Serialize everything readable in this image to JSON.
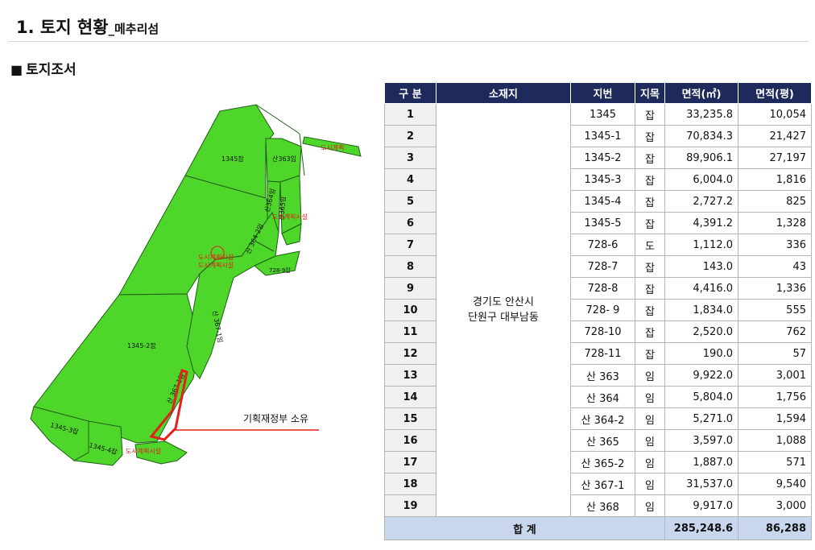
{
  "header": {
    "title": "1. 토지 현황",
    "subtitle": "_메추리섬"
  },
  "section": {
    "marker": "■",
    "title": "토지조서"
  },
  "map": {
    "parcels": [
      "1345잡",
      "1345-2잡",
      "1345-3잡",
      "1345-4잡",
      "산363임",
      "산364임",
      "산 367-1임",
      "산365임",
      "728-9잡",
      "산 364-2임",
      "산 367-1임"
    ],
    "overlay_labels": [
      "도시계획",
      "도시계획시설",
      "도시계획시설",
      "도시계획시설",
      "도시계획시설"
    ],
    "callout": "기획재정부 소유",
    "colors": {
      "parcel_fill": "#4fd62a",
      "parcel_border": "#1e5e14",
      "highlight": "#e3201b",
      "callout_line": "#e3201b"
    }
  },
  "table": {
    "headers": [
      "구 분",
      "소재지",
      "지번",
      "지목",
      "면적(㎡)",
      "면적(평)"
    ],
    "location": [
      "경기도 안산시",
      "단원구 대부남동"
    ],
    "rows": [
      {
        "no": "1",
        "lot": "1345",
        "cat": "잡",
        "sqm": "33,235.8",
        "pyeong": "10,054"
      },
      {
        "no": "2",
        "lot": "1345-1",
        "cat": "잡",
        "sqm": "70,834.3",
        "pyeong": "21,427"
      },
      {
        "no": "3",
        "lot": "1345-2",
        "cat": "잡",
        "sqm": "89,906.1",
        "pyeong": "27,197"
      },
      {
        "no": "4",
        "lot": "1345-3",
        "cat": "잡",
        "sqm": "6,004.0",
        "pyeong": "1,816"
      },
      {
        "no": "5",
        "lot": "1345-4",
        "cat": "잡",
        "sqm": "2,727.2",
        "pyeong": "825"
      },
      {
        "no": "6",
        "lot": "1345-5",
        "cat": "잡",
        "sqm": "4,391.2",
        "pyeong": "1,328"
      },
      {
        "no": "7",
        "lot": "728-6",
        "cat": "도",
        "sqm": "1,112.0",
        "pyeong": "336"
      },
      {
        "no": "8",
        "lot": "728-7",
        "cat": "잡",
        "sqm": "143.0",
        "pyeong": "43"
      },
      {
        "no": "9",
        "lot": "728-8",
        "cat": "잡",
        "sqm": "4,416.0",
        "pyeong": "1,336"
      },
      {
        "no": "10",
        "lot": "728- 9",
        "cat": "잡",
        "sqm": "1,834.0",
        "pyeong": "555"
      },
      {
        "no": "11",
        "lot": "728-10",
        "cat": "잡",
        "sqm": "2,520.0",
        "pyeong": "762"
      },
      {
        "no": "12",
        "lot": "728-11",
        "cat": "잡",
        "sqm": "190.0",
        "pyeong": "57"
      },
      {
        "no": "13",
        "lot": "산 363",
        "cat": "임",
        "sqm": "9,922.0",
        "pyeong": "3,001"
      },
      {
        "no": "14",
        "lot": "산 364",
        "cat": "임",
        "sqm": "5,804.0",
        "pyeong": "1,756"
      },
      {
        "no": "15",
        "lot": "산 364-2",
        "cat": "임",
        "sqm": "5,271.0",
        "pyeong": "1,594"
      },
      {
        "no": "16",
        "lot": "산 365",
        "cat": "임",
        "sqm": "3,597.0",
        "pyeong": "1,088"
      },
      {
        "no": "17",
        "lot": "산 365-2",
        "cat": "임",
        "sqm": "1,887.0",
        "pyeong": "571"
      },
      {
        "no": "18",
        "lot": "산 367-1",
        "cat": "임",
        "sqm": "31,537.0",
        "pyeong": "9,540"
      },
      {
        "no": "19",
        "lot": "산 368",
        "cat": "임",
        "sqm": "9,917.0",
        "pyeong": "3,000"
      }
    ],
    "total": {
      "label": "합 계",
      "sqm": "285,248.6",
      "pyeong": "86,288"
    }
  }
}
